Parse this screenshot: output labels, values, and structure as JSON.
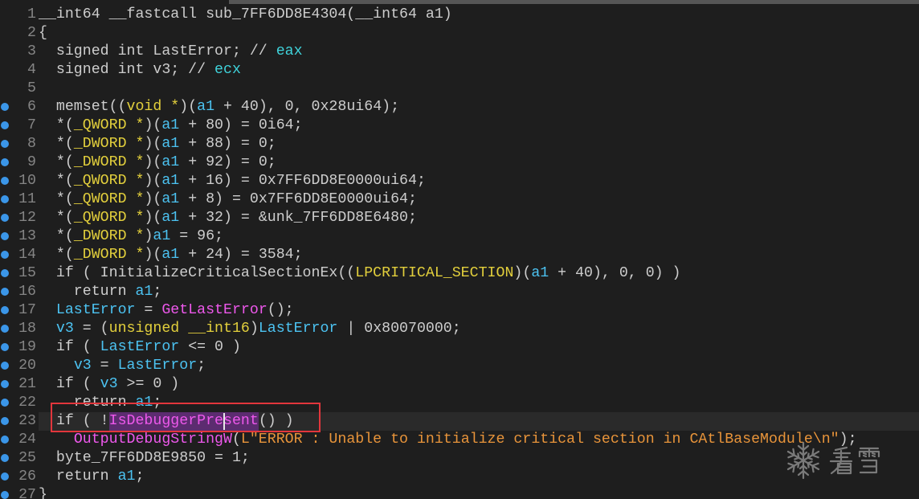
{
  "colors": {
    "background": "#1e1e1e",
    "text": "#cdcdcd",
    "line_number": "#858585",
    "address_dot": "#3b96e8",
    "current_line": "#2a2a2a",
    "selection": "#5c2c70",
    "caret": "#e8e8e8",
    "annotation": "#e2363c",
    "scrollbar": "#565656",
    "watermark": "#7a7a7a"
  },
  "token_colors": [
    "#cdcdcd",
    "#4cc3f2",
    "#e2cf3c",
    "#ee58ec",
    "#e8943a",
    "#3fd2da"
  ],
  "current_line": 23,
  "caret": {
    "line": 23,
    "column": 22
  },
  "lines": [
    {
      "num": "1",
      "dot": false,
      "tokens": [
        [
          "__int64 __fastcall sub_7FF6DD8E4304(__int64 a1)",
          0
        ]
      ]
    },
    {
      "num": "2",
      "dot": false,
      "tokens": [
        [
          "{",
          0
        ]
      ]
    },
    {
      "num": "3",
      "dot": false,
      "tokens": [
        [
          "  signed int LastError; // ",
          0
        ],
        [
          "eax",
          5
        ]
      ]
    },
    {
      "num": "4",
      "dot": false,
      "tokens": [
        [
          "  signed int v3; // ",
          0
        ],
        [
          "ecx",
          5
        ]
      ]
    },
    {
      "num": "5",
      "dot": false,
      "tokens": []
    },
    {
      "num": "6",
      "dot": true,
      "tokens": [
        [
          "  memset((",
          0
        ],
        [
          "void *",
          2
        ],
        [
          ")(",
          0
        ],
        [
          "a1",
          1
        ],
        [
          " + 40), 0, 0x28ui64);",
          0
        ]
      ]
    },
    {
      "num": "7",
      "dot": true,
      "tokens": [
        [
          "  *(",
          0
        ],
        [
          "_QWORD *",
          2
        ],
        [
          ")(",
          0
        ],
        [
          "a1",
          1
        ],
        [
          " + 80) = 0i64;",
          0
        ]
      ]
    },
    {
      "num": "8",
      "dot": true,
      "tokens": [
        [
          "  *(",
          0
        ],
        [
          "_DWORD *",
          2
        ],
        [
          ")(",
          0
        ],
        [
          "a1",
          1
        ],
        [
          " + 88) = 0;",
          0
        ]
      ]
    },
    {
      "num": "9",
      "dot": true,
      "tokens": [
        [
          "  *(",
          0
        ],
        [
          "_DWORD *",
          2
        ],
        [
          ")(",
          0
        ],
        [
          "a1",
          1
        ],
        [
          " + 92) = 0;",
          0
        ]
      ]
    },
    {
      "num": "10",
      "dot": true,
      "tokens": [
        [
          "  *(",
          0
        ],
        [
          "_QWORD *",
          2
        ],
        [
          ")(",
          0
        ],
        [
          "a1",
          1
        ],
        [
          " + 16) = 0x7FF6DD8E0000ui64;",
          0
        ]
      ]
    },
    {
      "num": "11",
      "dot": true,
      "tokens": [
        [
          "  *(",
          0
        ],
        [
          "_QWORD *",
          2
        ],
        [
          ")(",
          0
        ],
        [
          "a1",
          1
        ],
        [
          " + 8) = 0x7FF6DD8E0000ui64;",
          0
        ]
      ]
    },
    {
      "num": "12",
      "dot": true,
      "tokens": [
        [
          "  *(",
          0
        ],
        [
          "_QWORD *",
          2
        ],
        [
          ")(",
          0
        ],
        [
          "a1",
          1
        ],
        [
          " + 32) = &unk_7FF6DD8E6480;",
          0
        ]
      ]
    },
    {
      "num": "13",
      "dot": true,
      "tokens": [
        [
          "  *(",
          0
        ],
        [
          "_DWORD *",
          2
        ],
        [
          ")",
          0
        ],
        [
          "a1",
          1
        ],
        [
          " = 96;",
          0
        ]
      ]
    },
    {
      "num": "14",
      "dot": true,
      "tokens": [
        [
          "  *(",
          0
        ],
        [
          "_DWORD *",
          2
        ],
        [
          ")(",
          0
        ],
        [
          "a1",
          1
        ],
        [
          " + 24) = 3584;",
          0
        ]
      ]
    },
    {
      "num": "15",
      "dot": true,
      "tokens": [
        [
          "  if ( InitializeCriticalSectionEx((",
          0
        ],
        [
          "LPCRITICAL_SECTION",
          2
        ],
        [
          ")(",
          0
        ],
        [
          "a1",
          1
        ],
        [
          " + 40), 0, 0) )",
          0
        ]
      ]
    },
    {
      "num": "16",
      "dot": true,
      "tokens": [
        [
          "    return ",
          0
        ],
        [
          "a1",
          1
        ],
        [
          ";",
          0
        ]
      ]
    },
    {
      "num": "17",
      "dot": true,
      "tokens": [
        [
          "  ",
          0
        ],
        [
          "LastError",
          1
        ],
        [
          " = ",
          0
        ],
        [
          "GetLastError",
          3
        ],
        [
          "();",
          0
        ]
      ]
    },
    {
      "num": "18",
      "dot": true,
      "tokens": [
        [
          "  ",
          0
        ],
        [
          "v3",
          1
        ],
        [
          " = (",
          0
        ],
        [
          "unsigned __int16",
          2
        ],
        [
          ")",
          0
        ],
        [
          "LastError",
          1
        ],
        [
          " | 0x80070000;",
          0
        ]
      ]
    },
    {
      "num": "19",
      "dot": true,
      "tokens": [
        [
          "  if ( ",
          0
        ],
        [
          "LastError",
          1
        ],
        [
          " <= 0 )",
          0
        ]
      ]
    },
    {
      "num": "20",
      "dot": true,
      "tokens": [
        [
          "    ",
          0
        ],
        [
          "v3",
          1
        ],
        [
          " = ",
          0
        ],
        [
          "LastError",
          1
        ],
        [
          ";",
          0
        ]
      ]
    },
    {
      "num": "21",
      "dot": true,
      "tokens": [
        [
          "  if ( ",
          0
        ],
        [
          "v3",
          1
        ],
        [
          " >= 0 )",
          0
        ]
      ]
    },
    {
      "num": "22",
      "dot": true,
      "tokens": [
        [
          "    return ",
          0
        ],
        [
          "a1",
          1
        ],
        [
          ";",
          0
        ]
      ]
    },
    {
      "num": "23",
      "dot": true,
      "tokens": [
        [
          "  if ( !",
          0
        ],
        [
          "IsDebuggerPresent",
          3,
          true
        ],
        [
          "() )",
          0
        ]
      ]
    },
    {
      "num": "24",
      "dot": true,
      "tokens": [
        [
          "    ",
          0
        ],
        [
          "OutputDebugStringW",
          3
        ],
        [
          "(",
          0
        ],
        [
          "L\"ERROR : Unable to initialize critical section in CAtlBaseModule\\n\"",
          4
        ],
        [
          ");",
          0
        ]
      ]
    },
    {
      "num": "25",
      "dot": true,
      "tokens": [
        [
          "  byte_7FF6DD8E9850 = 1;",
          0
        ]
      ]
    },
    {
      "num": "26",
      "dot": true,
      "tokens": [
        [
          "  return ",
          0
        ],
        [
          "a1",
          1
        ],
        [
          ";",
          0
        ]
      ]
    },
    {
      "num": "27",
      "dot": true,
      "tokens": [
        [
          "}",
          0
        ]
      ]
    }
  ],
  "watermark": {
    "text": "看雪",
    "icon": "snowflake-icon"
  }
}
